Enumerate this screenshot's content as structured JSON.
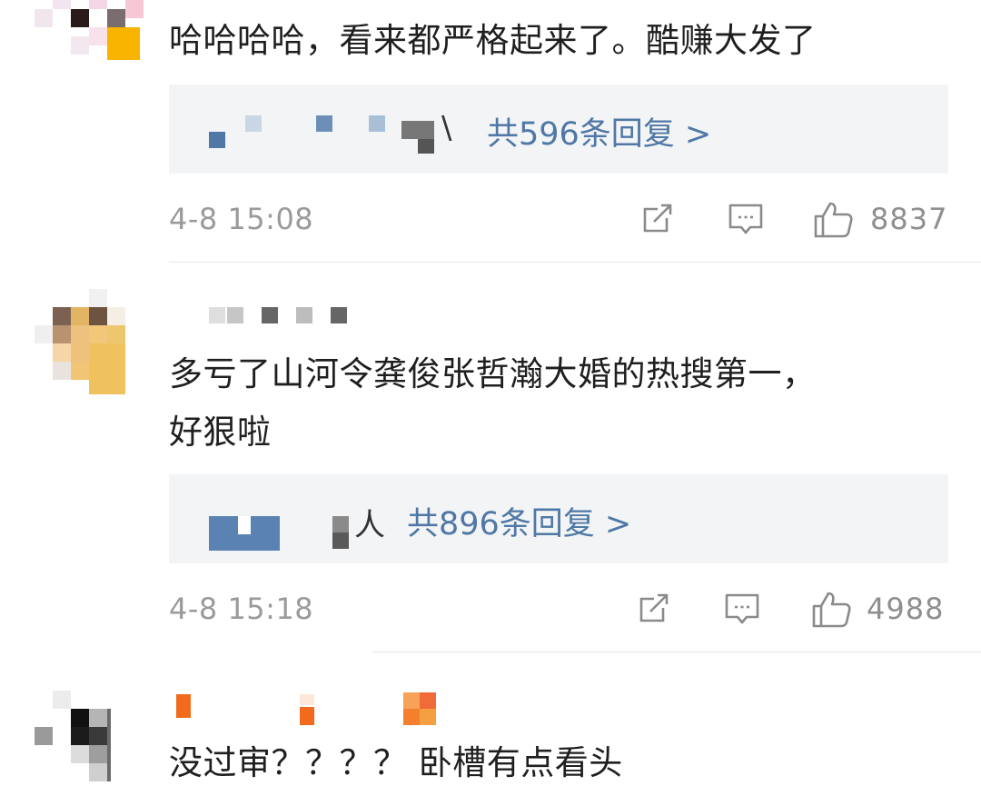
{
  "comments": [
    {
      "text": "哈哈哈哈，看来都严格起来了。酷赚大发了",
      "reply_prefix_tail": "\\",
      "reply_count_label": "共596条回复 >",
      "time": "4-8 15:08",
      "likes": "8837"
    },
    {
      "text": "多亏了山河令龚俊张哲瀚大婚的热搜第一，",
      "text_line2": "好狠啦",
      "reply_prefix_tail": "人",
      "reply_count_label": "共896条回复 >",
      "time": "4-8 15:18",
      "likes": "4988"
    },
    {
      "text": "没过审？？？？ 卧槽有点看头"
    }
  ],
  "icons": {
    "share": "share-icon",
    "comment": "comment-icon",
    "like": "thumbs-up-icon"
  },
  "colors": {
    "link": "#4f78a6",
    "meta": "#9a9a9a",
    "reply_bg": "#f3f4f6"
  }
}
